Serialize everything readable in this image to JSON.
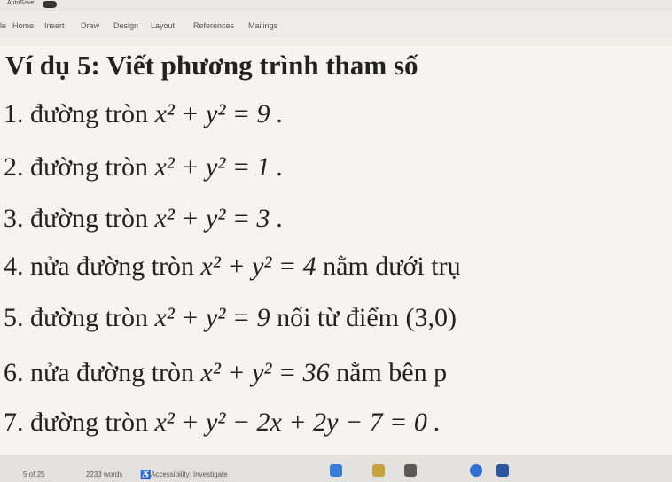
{
  "titlebar": {
    "autosave": "AutoSave"
  },
  "ribbon": {
    "tabs": [
      "le",
      "Home",
      "Insert",
      "Draw",
      "Design",
      "Layout",
      "References",
      "Mailings"
    ]
  },
  "document": {
    "title": "Ví dụ 5: Viết phương trình tham số",
    "items": [
      {
        "text": "1. đường tròn ",
        "math": "x² + y² = 9 .",
        "rest": ""
      },
      {
        "text": "2. đường tròn ",
        "math": "x² + y² = 1 .",
        "rest": ""
      },
      {
        "text": "3. đường tròn ",
        "math": "x² + y² = 3 .",
        "rest": ""
      },
      {
        "text": "4. nửa đường tròn ",
        "math": "x² + y² = 4",
        "rest": " nằm dưới trụ"
      },
      {
        "text": "5. đường tròn ",
        "math": "x² + y² = 9",
        "rest": " nối từ điểm (3,0)"
      },
      {
        "text": "6. nửa đường tròn ",
        "math": "x² + y² = 36",
        "rest": " nằm bên p"
      },
      {
        "text": "7. đường tròn ",
        "math": "x² + y² − 2x + 2y − 7 = 0 .",
        "rest": ""
      }
    ]
  },
  "statusbar": {
    "page": "5 of 25",
    "words": "2233 words",
    "accessibility": "Accessibility: Investigate"
  }
}
